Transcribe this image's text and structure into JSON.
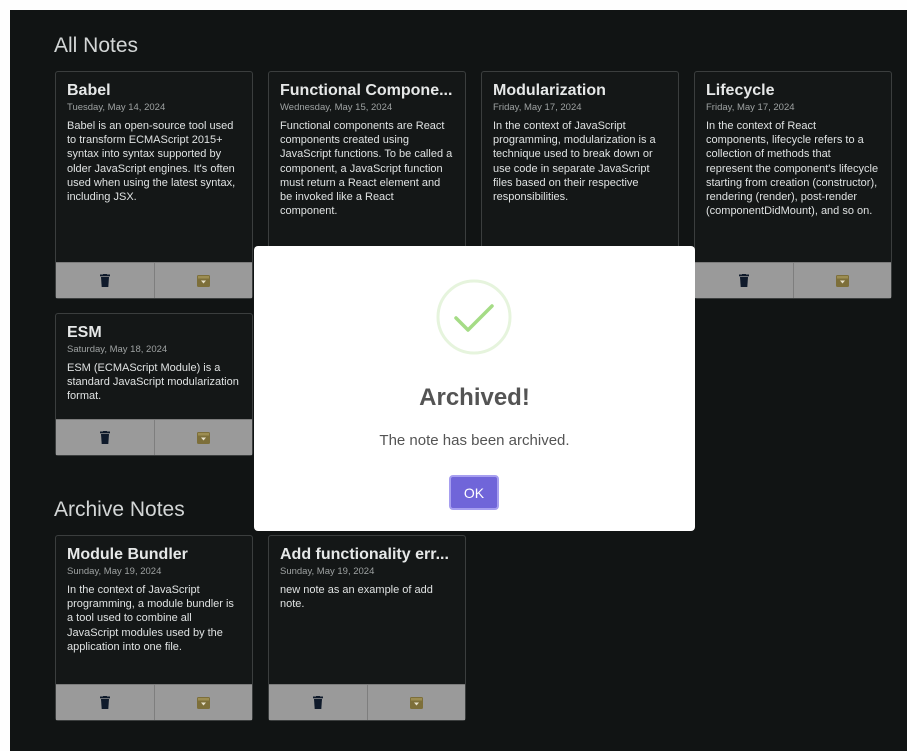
{
  "sections": {
    "all_notes_title": "All Notes",
    "archive_notes_title": "Archive Notes"
  },
  "all_notes": [
    {
      "title": "Babel",
      "date": "Tuesday, May 14, 2024",
      "body": "Babel is an open-source tool used to transform ECMAScript 2015+ syntax into syntax supported by older JavaScript engines. It's often used when using the latest syntax, including JSX."
    },
    {
      "title": "Functional Compone...",
      "date": "Wednesday, May 15, 2024",
      "body": "Functional components are React components created using JavaScript functions. To be called a component, a JavaScript function must return a React element and be invoked like a React component."
    },
    {
      "title": "Modularization",
      "date": "Friday, May 17, 2024",
      "body": "In the context of JavaScript programming, modularization is a technique used to break down or use code in separate JavaScript files based on their respective responsibilities."
    },
    {
      "title": "Lifecycle",
      "date": "Friday, May 17, 2024",
      "body": "In the context of React components, lifecycle refers to a collection of methods that represent the component's lifecycle starting from creation (constructor), rendering (render), post-render (componentDidMount), and so on."
    },
    {
      "title": "ESM",
      "date": "Saturday, May 18, 2024",
      "body": "ESM (ECMAScript Module) is a standard JavaScript modularization format."
    }
  ],
  "archive_notes": [
    {
      "title": "Module Bundler",
      "date": "Sunday, May 19, 2024",
      "body": "In the context of JavaScript programming, a module bundler is a tool used to combine all JavaScript modules used by the application into one file."
    },
    {
      "title": "Add functionality err...",
      "date": "Sunday, May 19, 2024",
      "body": "new note as an example of add note."
    }
  ],
  "card_actions": {
    "delete_icon": "trash-icon",
    "archive_icon": "archive-box-icon"
  },
  "modal": {
    "icon": "check-circle-icon",
    "title": "Archived!",
    "text": "The note has been archived.",
    "ok_label": "OK"
  },
  "colors": {
    "background": "#111414",
    "card_action_bar": "#9a9a9a",
    "trash_icon": "#0f1a2b",
    "archive_icon": "#7d6f3a",
    "ok_button": "#7065d9",
    "success": "#a5dc86"
  }
}
